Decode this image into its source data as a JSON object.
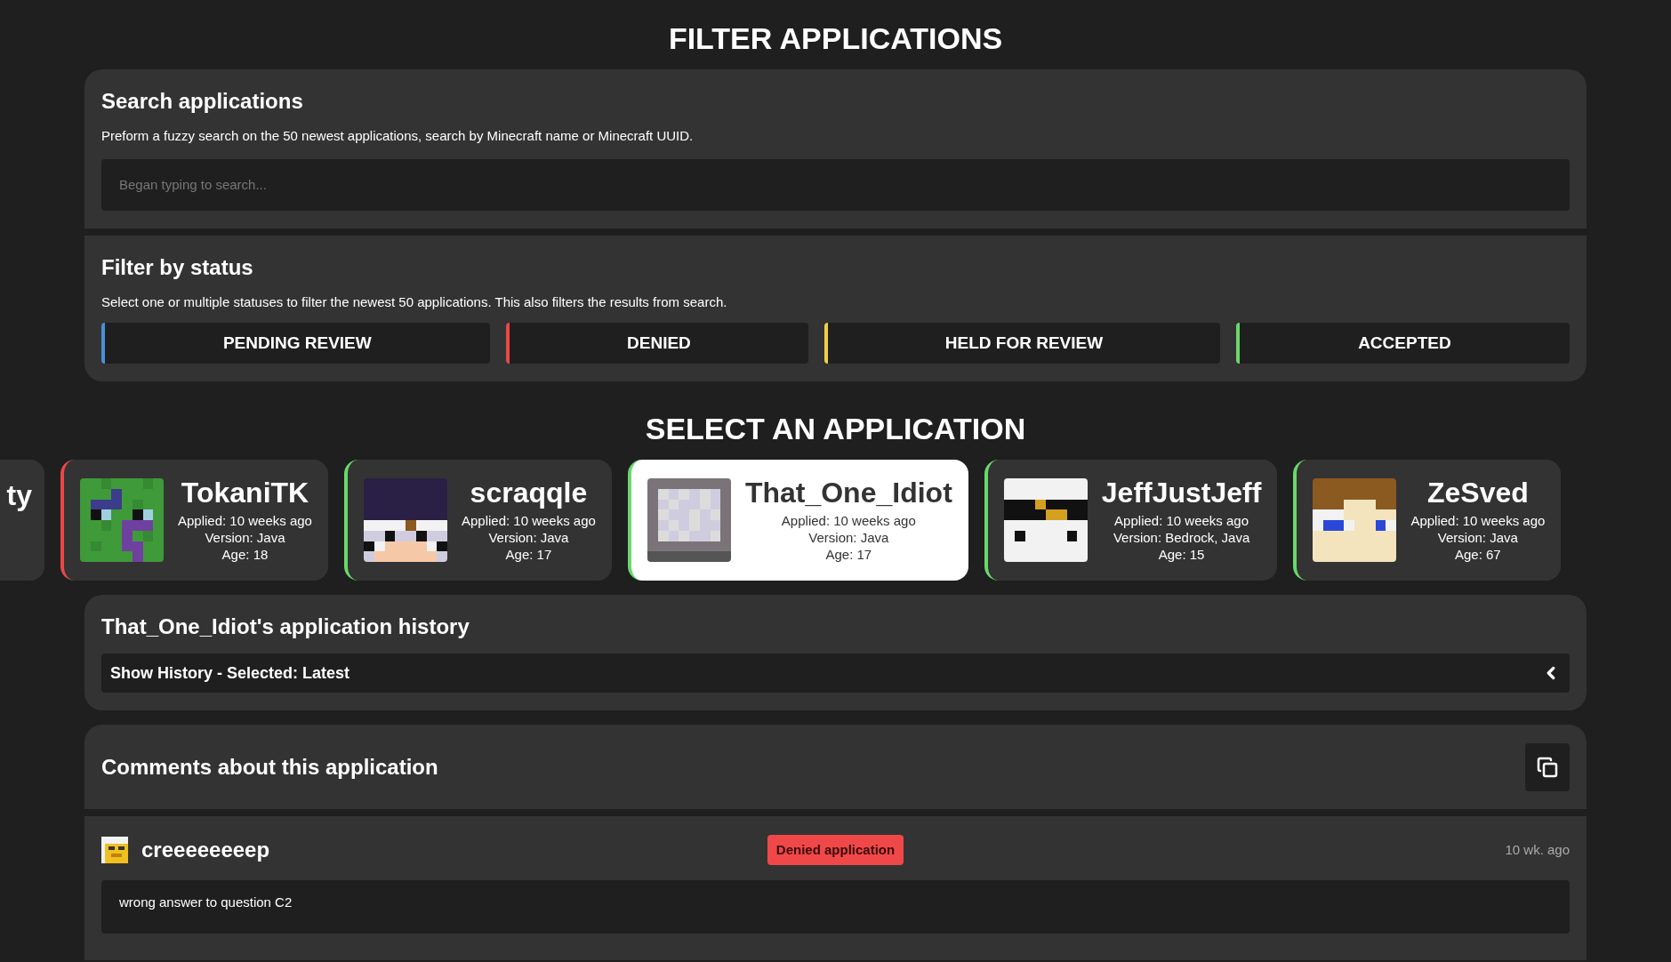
{
  "page_title": "FILTER APPLICATIONS",
  "search": {
    "title": "Search applications",
    "description": "Preform a fuzzy search on the 50 newest applications, search by Minecraft name or Minecraft UUID.",
    "placeholder": "Began typing to search..."
  },
  "filter": {
    "title": "Filter by status",
    "description": "Select one or multiple statuses to filter the newest 50 applications. This also filters the results from search.",
    "statuses": [
      {
        "label": "PENDING REVIEW",
        "color": "#4a90d9"
      },
      {
        "label": "DENIED",
        "color": "#e84848"
      },
      {
        "label": "HELD FOR REVIEW",
        "color": "#f0d040"
      },
      {
        "label": "ACCEPTED",
        "color": "#6ad86a"
      }
    ]
  },
  "select_title": "SELECT AN APPLICATION",
  "partial_card": {
    "name_fragment": "ty"
  },
  "applications": [
    {
      "name": "TokaniTK",
      "applied": "Applied: 10 weeks ago",
      "version": "Version: Java",
      "age": "Age: 18",
      "color": "#e84848",
      "selected": false
    },
    {
      "name": "scraqqle",
      "applied": "Applied: 10 weeks ago",
      "version": "Version: Java",
      "age": "Age: 17",
      "color": "#6ad86a",
      "selected": false
    },
    {
      "name": "That_One_Idiot",
      "applied": "Applied: 10 weeks ago",
      "version": "Version: Java",
      "age": "Age: 17",
      "color": "#6ad86a",
      "selected": true
    },
    {
      "name": "JeffJustJeff",
      "applied": "Applied: 10 weeks ago",
      "version": "Version: Bedrock, Java",
      "age": "Age: 15",
      "color": "#6ad86a",
      "selected": false
    },
    {
      "name": "ZeSved",
      "applied": "Applied: 10 weeks ago",
      "version": "Version: Java",
      "age": "Age: 67",
      "color": "#6ad86a",
      "selected": false
    }
  ],
  "history": {
    "title": "That_One_Idiot's application history",
    "toggle_label": "Show History - Selected: Latest",
    "expanded": false
  },
  "comments": {
    "title": "Comments about this application",
    "items": [
      {
        "author": "creeeeeeeep",
        "badge": {
          "label": "Denied application",
          "kind": "denied"
        },
        "time": "10 wk. ago",
        "text": "wrong answer to question C2"
      }
    ]
  }
}
